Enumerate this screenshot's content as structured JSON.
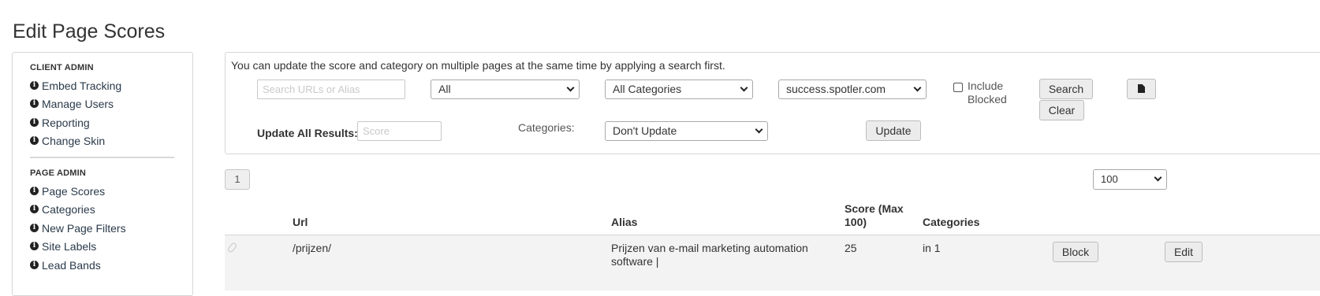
{
  "page": {
    "title": "Edit Page Scores"
  },
  "sidebar": {
    "client_admin_heading": "CLIENT ADMIN",
    "client_admin_items": [
      {
        "label": "Embed Tracking"
      },
      {
        "label": "Manage Users"
      },
      {
        "label": "Reporting"
      },
      {
        "label": "Change Skin"
      }
    ],
    "page_admin_heading": "PAGE ADMIN",
    "page_admin_items": [
      {
        "label": "Page Scores"
      },
      {
        "label": "Categories"
      },
      {
        "label": "New Page Filters"
      },
      {
        "label": "Site Labels"
      },
      {
        "label": "Lead Bands"
      }
    ]
  },
  "search_panel": {
    "intro": "You can update the score and category on multiple pages at the same time by applying a search first.",
    "search_placeholder": "Search URLs or Alias",
    "filter_select": "All",
    "category_select": "All Categories",
    "domain_select": "success.spotler.com",
    "include_blocked_line1": "Include",
    "include_blocked_line2": "Blocked",
    "include_blocked_checked": false,
    "search_button": "Search",
    "clear_button": "Clear",
    "update_all_label": "Update All Results:",
    "score_placeholder": "Score",
    "categories_label": "Categories:",
    "update_category_select": "Don't Update",
    "update_button": "Update",
    "export_icon": "document-icon"
  },
  "pagination": {
    "current_page": "1",
    "per_page": "100"
  },
  "table": {
    "headers": {
      "url": "Url",
      "alias": "Alias",
      "score_line1": "Score (Max",
      "score_line2": "100)",
      "categories": "Categories"
    },
    "rows": [
      {
        "url": "/prijzen/",
        "alias_line1": "Prijzen van e-mail marketing automation",
        "alias_line2": "software |",
        "score": "25",
        "categories": "in 1",
        "block_label": "Block",
        "edit_label": "Edit"
      }
    ]
  },
  "colors": {
    "border": "#d6d6d6",
    "button_bg": "#ececec",
    "row_bg": "#f3f3f3",
    "text": "#333333"
  }
}
